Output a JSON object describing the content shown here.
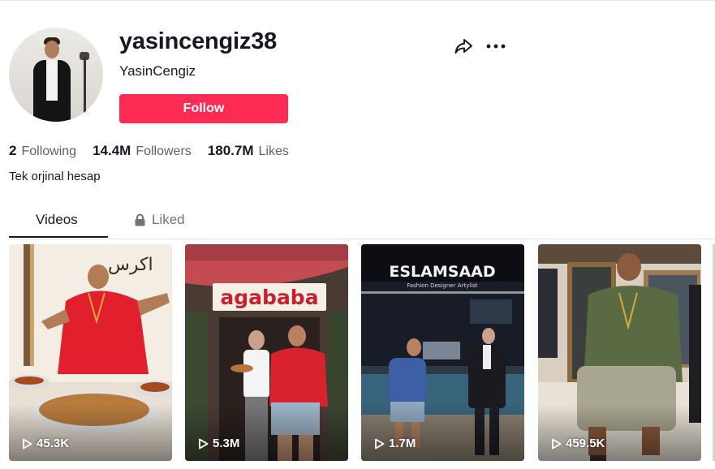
{
  "profile": {
    "username": "yasincengiz38",
    "nickname": "YasinCengiz",
    "follow_label": "Follow",
    "bio": "Tek orjinal hesap"
  },
  "stats": {
    "following_count": "2",
    "following_label": "Following",
    "followers_count": "14.4M",
    "followers_label": "Followers",
    "likes_count": "180.7M",
    "likes_label": "Likes"
  },
  "tabs": {
    "videos": "Videos",
    "liked": "Liked"
  },
  "videos": [
    {
      "views": "45.3K",
      "sign": "اكرس"
    },
    {
      "views": "5.3M",
      "sign": "agababa"
    },
    {
      "views": "1.7M",
      "sign": "ESLAMSAAD",
      "sign_sub": "Fashion Designer Artylist"
    },
    {
      "views": "459.5K"
    }
  ],
  "colors": {
    "follow": "#fe2c55",
    "text": "#161823",
    "muted": "#73747b"
  },
  "icons": [
    "share-icon",
    "more-icon",
    "lock-icon",
    "play-icon"
  ]
}
